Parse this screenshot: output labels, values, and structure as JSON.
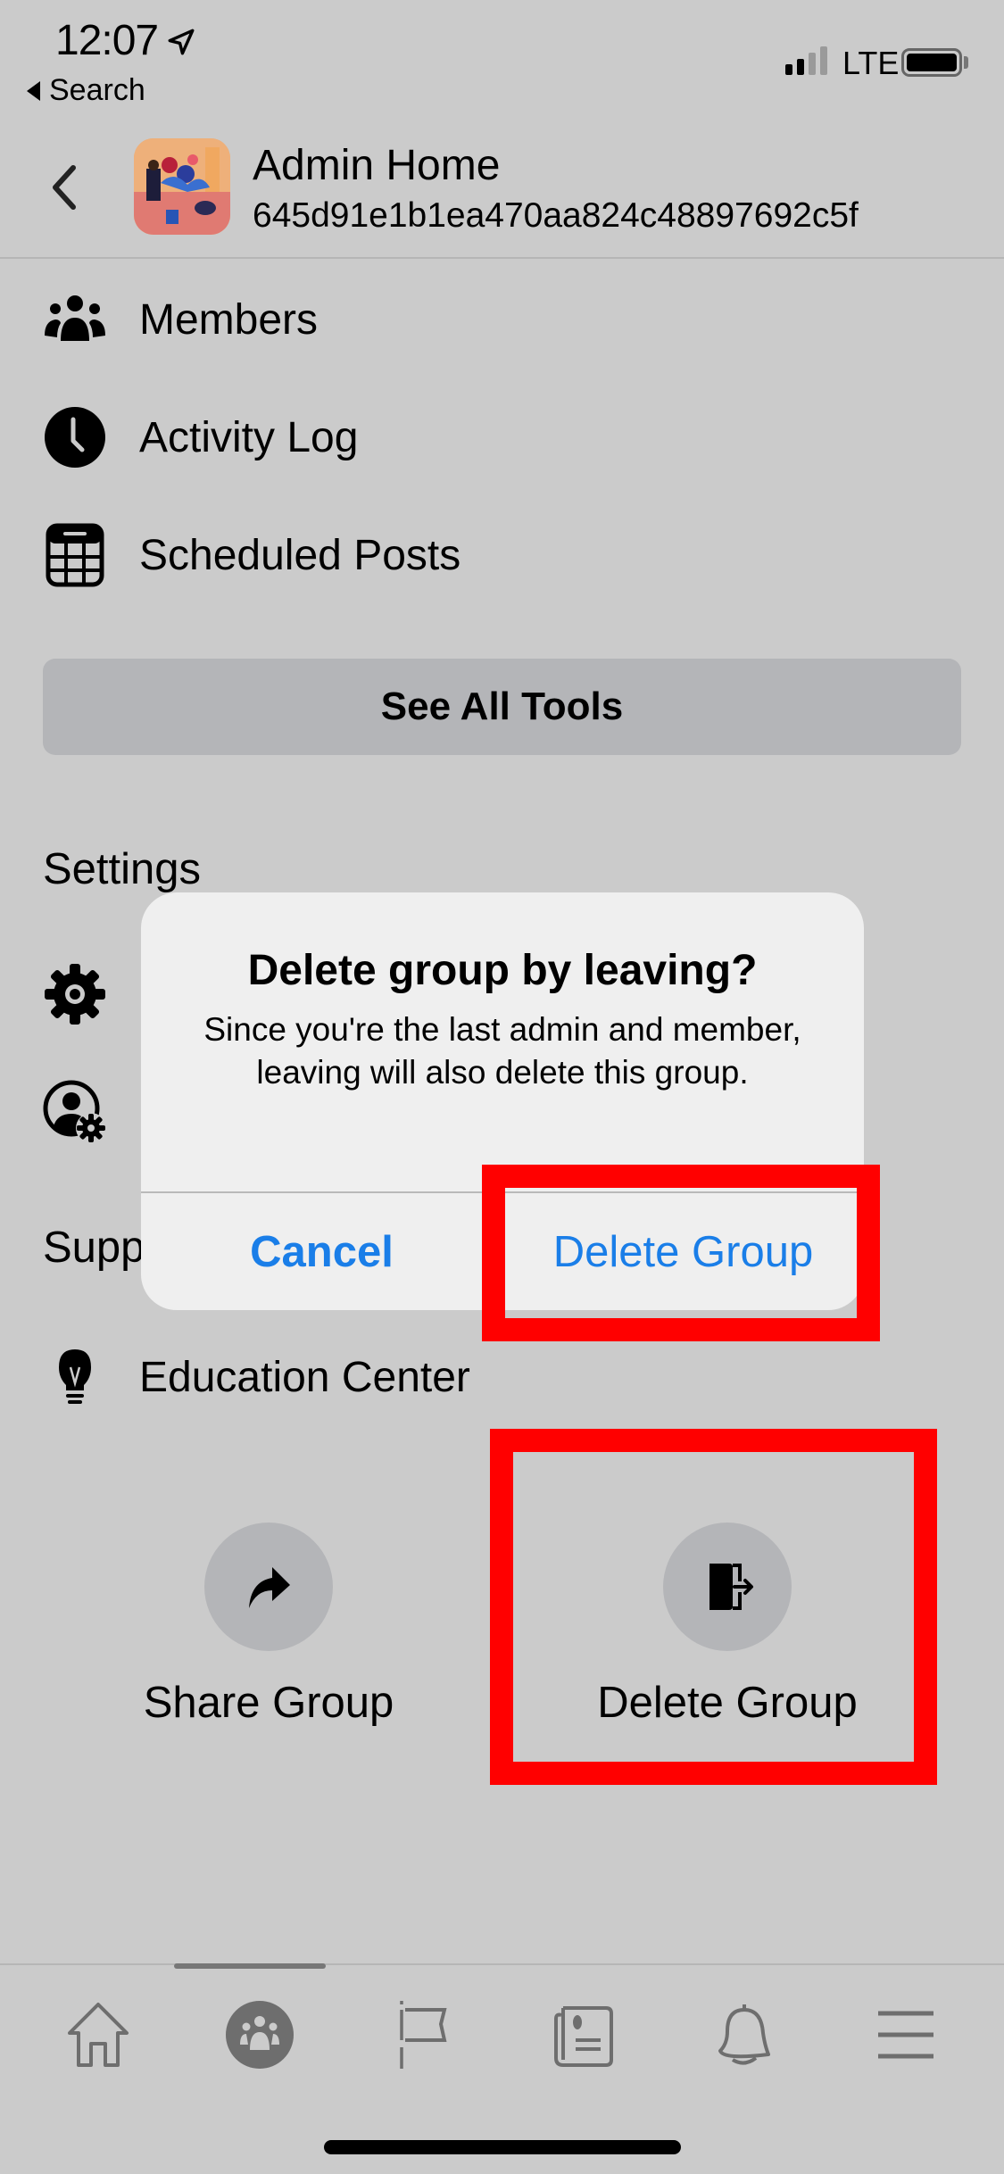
{
  "status_bar": {
    "time": "12:07",
    "back_app": "Search",
    "network": "LTE",
    "signal_bars_active": 2,
    "signal_bars_total": 4
  },
  "header": {
    "title": "Admin Home",
    "subtitle": "645d91e1b1ea470aa824c48897692c5f",
    "back_icon": "chevron-left-icon"
  },
  "tools": [
    {
      "label": "Members",
      "icon": "members-icon"
    },
    {
      "label": "Activity Log",
      "icon": "clock-icon"
    },
    {
      "label": "Scheduled Posts",
      "icon": "calendar-icon"
    }
  ],
  "see_all_label": "See All Tools",
  "settings": {
    "heading": "Settings",
    "items": [
      {
        "icon": "gear-icon"
      },
      {
        "icon": "person-gear-icon"
      }
    ]
  },
  "support": {
    "heading": "Support",
    "items": [
      {
        "label": "Education Center",
        "icon": "lightbulb-icon"
      }
    ]
  },
  "actions": [
    {
      "label": "Share Group",
      "icon": "share-arrow-icon"
    },
    {
      "label": "Delete Group",
      "icon": "exit-door-icon"
    }
  ],
  "bottom_nav": [
    {
      "name": "home",
      "icon": "home-icon",
      "active": false
    },
    {
      "name": "groups",
      "icon": "groups-icon",
      "active": true
    },
    {
      "name": "pages",
      "icon": "flag-icon",
      "active": false
    },
    {
      "name": "news",
      "icon": "newspaper-icon",
      "active": false
    },
    {
      "name": "notifications",
      "icon": "bell-icon",
      "active": false
    },
    {
      "name": "menu",
      "icon": "menu-icon",
      "active": false
    }
  ],
  "dialog": {
    "title": "Delete group by leaving?",
    "message": "Since you're the last admin and member, leaving will also delete this group.",
    "cancel_label": "Cancel",
    "confirm_label": "Delete Group"
  },
  "colors": {
    "background": "#cbcbcb",
    "dialog_button": "#1a7ee8",
    "highlight": "#ff0000"
  }
}
